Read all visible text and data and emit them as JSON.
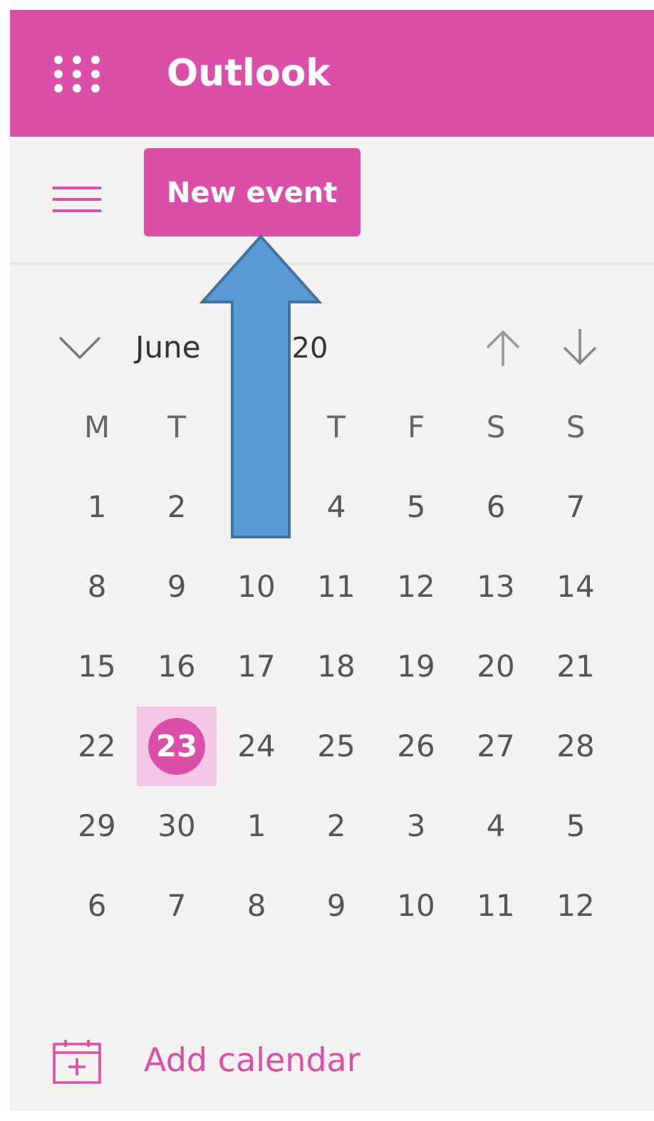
{
  "header": {
    "title": "Outlook"
  },
  "toolbar": {
    "new_event": "New event"
  },
  "calendar": {
    "month": "June",
    "year": "20",
    "weekdays": [
      {
        "label": "M"
      },
      {
        "label": "T"
      },
      {
        "covered": true
      },
      {
        "label": "T"
      },
      {
        "label": "F"
      },
      {
        "label": "S"
      },
      {
        "label": "S"
      }
    ],
    "weeks": [
      [
        {
          "day": "1",
          "selected": false
        },
        {
          "day": "2",
          "selected": false
        },
        {
          "covered": true
        },
        {
          "day": "4",
          "selected": false
        },
        {
          "day": "5",
          "selected": false
        },
        {
          "day": "6",
          "selected": false
        },
        {
          "day": "7",
          "selected": false
        }
      ],
      [
        {
          "day": "8",
          "selected": false
        },
        {
          "day": "9",
          "selected": false
        },
        {
          "day": "10",
          "selected": false
        },
        {
          "day": "11",
          "selected": false
        },
        {
          "day": "12",
          "selected": false
        },
        {
          "day": "13",
          "selected": false
        },
        {
          "day": "14",
          "selected": false
        }
      ],
      [
        {
          "day": "15",
          "selected": false
        },
        {
          "day": "16",
          "selected": false
        },
        {
          "day": "17",
          "selected": false
        },
        {
          "day": "18",
          "selected": false
        },
        {
          "day": "19",
          "selected": false
        },
        {
          "day": "20",
          "selected": false
        },
        {
          "day": "21",
          "selected": false
        }
      ],
      [
        {
          "day": "22",
          "selected": false
        },
        {
          "day": "23",
          "selected": true
        },
        {
          "day": "24",
          "selected": false
        },
        {
          "day": "25",
          "selected": false
        },
        {
          "day": "26",
          "selected": false
        },
        {
          "day": "27",
          "selected": false
        },
        {
          "day": "28",
          "selected": false
        }
      ],
      [
        {
          "day": "29",
          "selected": false
        },
        {
          "day": "30",
          "selected": false
        },
        {
          "day": "1",
          "selected": false
        },
        {
          "day": "2",
          "selected": false
        },
        {
          "day": "3",
          "selected": false
        },
        {
          "day": "4",
          "selected": false
        },
        {
          "day": "5",
          "selected": false
        }
      ],
      [
        {
          "day": "6",
          "selected": false
        },
        {
          "day": "7",
          "selected": false
        },
        {
          "day": "8",
          "selected": false
        },
        {
          "day": "9",
          "selected": false
        },
        {
          "day": "10",
          "selected": false
        },
        {
          "day": "11",
          "selected": false
        },
        {
          "day": "12",
          "selected": false
        }
      ]
    ]
  },
  "add_calendar": "Add calendar"
}
